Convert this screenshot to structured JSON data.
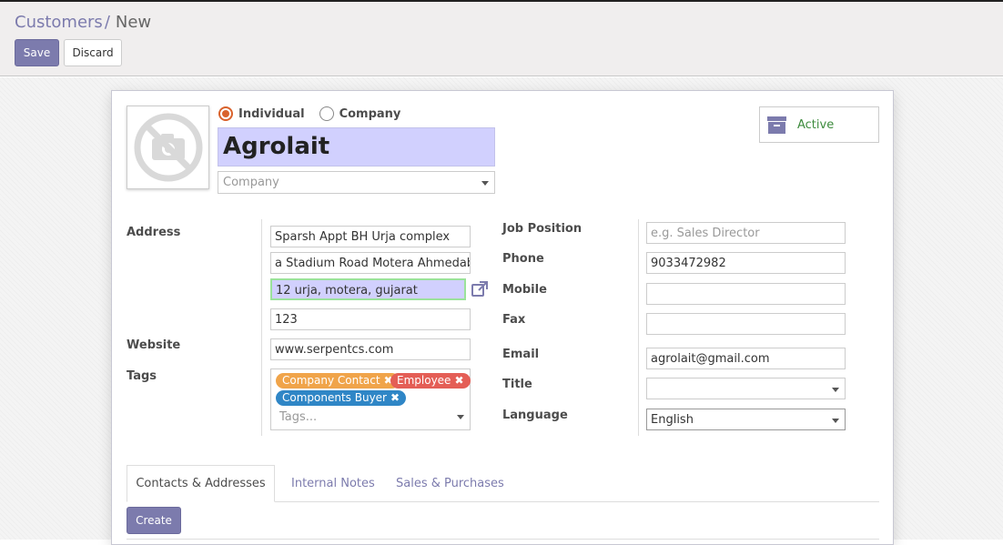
{
  "breadcrumb": {
    "parent": "Customers",
    "separator": "/",
    "current": "New"
  },
  "toolbar": {
    "save_label": "Save",
    "discard_label": "Discard"
  },
  "partner_type": {
    "individual_label": "Individual",
    "company_label": "Company",
    "selected": "Individual"
  },
  "name": "Agrolait",
  "company_field": {
    "placeholder": "Company"
  },
  "status_button": {
    "label": "Active",
    "icon": "archive-icon"
  },
  "address": {
    "label": "Address",
    "street": "Sparsh Appt BH Urja complex",
    "street2": "a Stadium Road Motera Ahmedabad",
    "city": "12 urja, motera, gujarat",
    "zip": "123"
  },
  "website": {
    "label": "Website",
    "value": "www.serpentcs.com"
  },
  "tags": {
    "label": "Tags",
    "items": [
      {
        "label": "Company Contact",
        "color": "#f0a44a"
      },
      {
        "label": "Employee",
        "color": "#e45e56"
      },
      {
        "label": "Components Buyer",
        "color": "#2f86c6"
      }
    ],
    "placeholder": "Tags..."
  },
  "job_position": {
    "label": "Job Position",
    "placeholder": "e.g. Sales Director",
    "value": ""
  },
  "phone": {
    "label": "Phone",
    "value": "9033472982"
  },
  "mobile": {
    "label": "Mobile",
    "value": ""
  },
  "fax": {
    "label": "Fax",
    "value": ""
  },
  "email": {
    "label": "Email",
    "value": "agrolait@gmail.com"
  },
  "title_field": {
    "label": "Title",
    "value": ""
  },
  "language": {
    "label": "Language",
    "value": "English"
  },
  "notebook": {
    "tabs": [
      {
        "label": "Contacts & Addresses",
        "active": true
      },
      {
        "label": "Internal Notes",
        "active": false
      },
      {
        "label": "Sales & Purchases",
        "active": false
      }
    ]
  },
  "create_label": "Create",
  "colors": {
    "accent": "#7c7bad",
    "active_status": "#3d8b3d",
    "radio_checked": "#d9622c",
    "edit_highlight": "#d1d0fe"
  }
}
